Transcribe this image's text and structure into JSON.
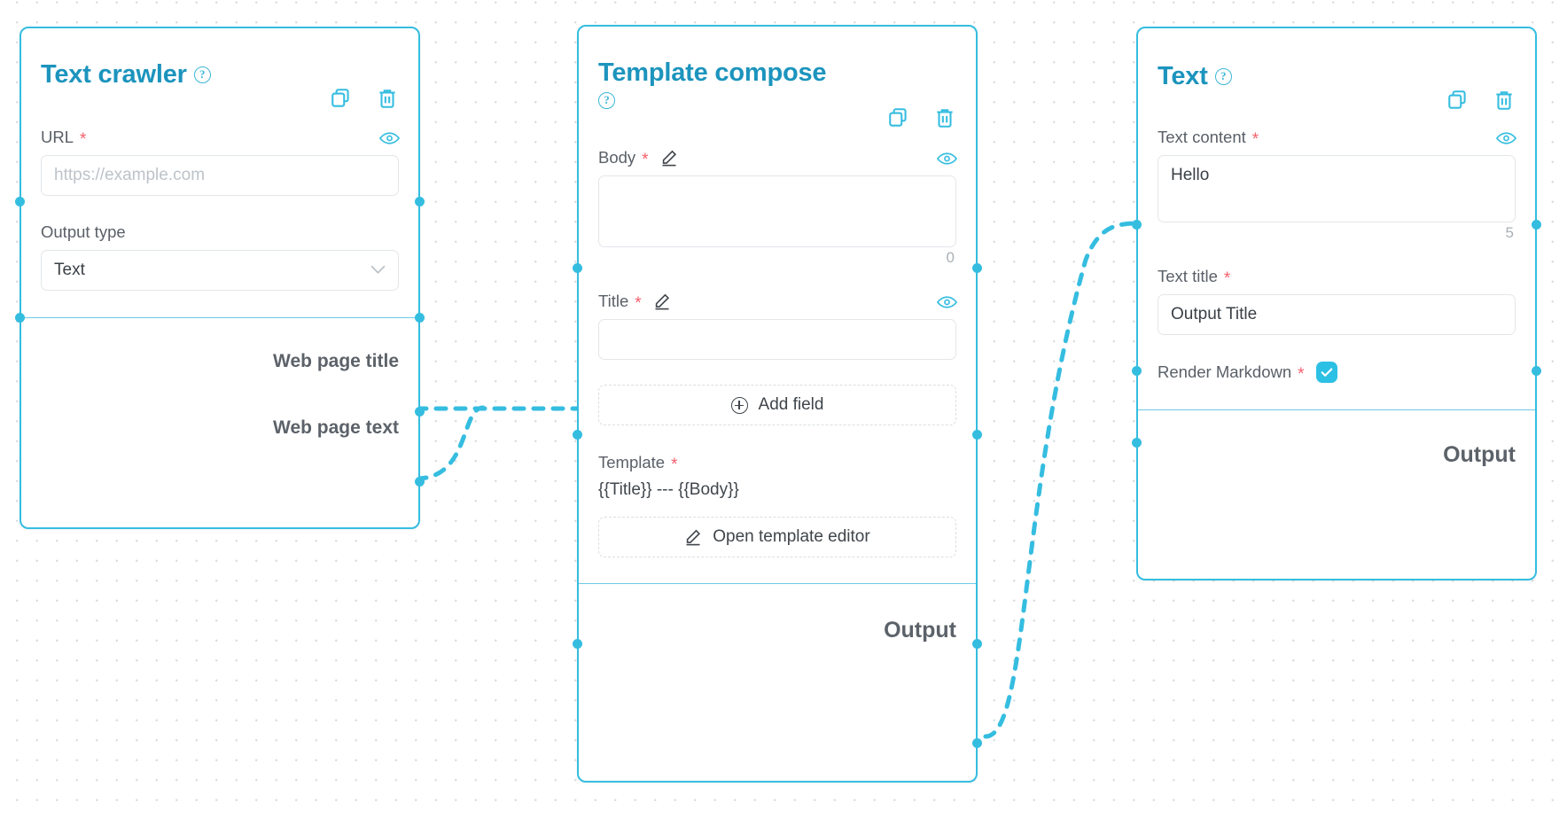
{
  "canvas": {
    "accent_color": "#35bde0",
    "title_color": "#1c94bd",
    "required_color": "#f4606c"
  },
  "nodes": [
    {
      "id": "text-crawler",
      "title": "Text crawler",
      "help_icon": "help-circle-icon",
      "copy_icon": "copy-icon",
      "delete_icon": "trash-icon",
      "fields": [
        {
          "label": "URL",
          "required": "*",
          "eye_icon": "eye-icon",
          "placeholder": "https://example.com",
          "value": ""
        },
        {
          "label": "Output type",
          "required": "",
          "value": "Text",
          "chevron": "chevron-down-icon"
        }
      ],
      "outputs": [
        "Web page title",
        "Web page text"
      ]
    },
    {
      "id": "template-compose",
      "title": "Template compose",
      "help_icon": "help-circle-icon",
      "copy_icon": "copy-icon",
      "delete_icon": "trash-icon",
      "fields": [
        {
          "label": "Body",
          "required": "*",
          "pencil_icon": "pencil-icon",
          "eye_icon": "eye-icon",
          "value": "",
          "counter": "0"
        },
        {
          "label": "Title",
          "required": "*",
          "pencil_icon": "pencil-icon",
          "eye_icon": "eye-icon",
          "value": ""
        }
      ],
      "add_field_label": "Add field",
      "add_field_icon": "plus-circle-icon",
      "template_label": "Template",
      "template_required": "*",
      "template_value": "{{Title}} --- {{Body}}",
      "open_editor_label": "Open template editor",
      "open_editor_icon": "pencil-icon",
      "outputs": [
        "Output"
      ]
    },
    {
      "id": "text",
      "title": "Text",
      "help_icon": "help-circle-icon",
      "copy_icon": "copy-icon",
      "delete_icon": "trash-icon",
      "fields": [
        {
          "label": "Text content",
          "required": "*",
          "eye_icon": "eye-icon",
          "value": "Hello",
          "counter": "5"
        },
        {
          "label": "Text title",
          "required": "*",
          "value": "Output Title"
        },
        {
          "label": "Render Markdown",
          "required": "*",
          "checkbox_icon": "checkbox-checked-icon",
          "checked": true
        }
      ],
      "outputs": [
        "Output"
      ]
    }
  ]
}
